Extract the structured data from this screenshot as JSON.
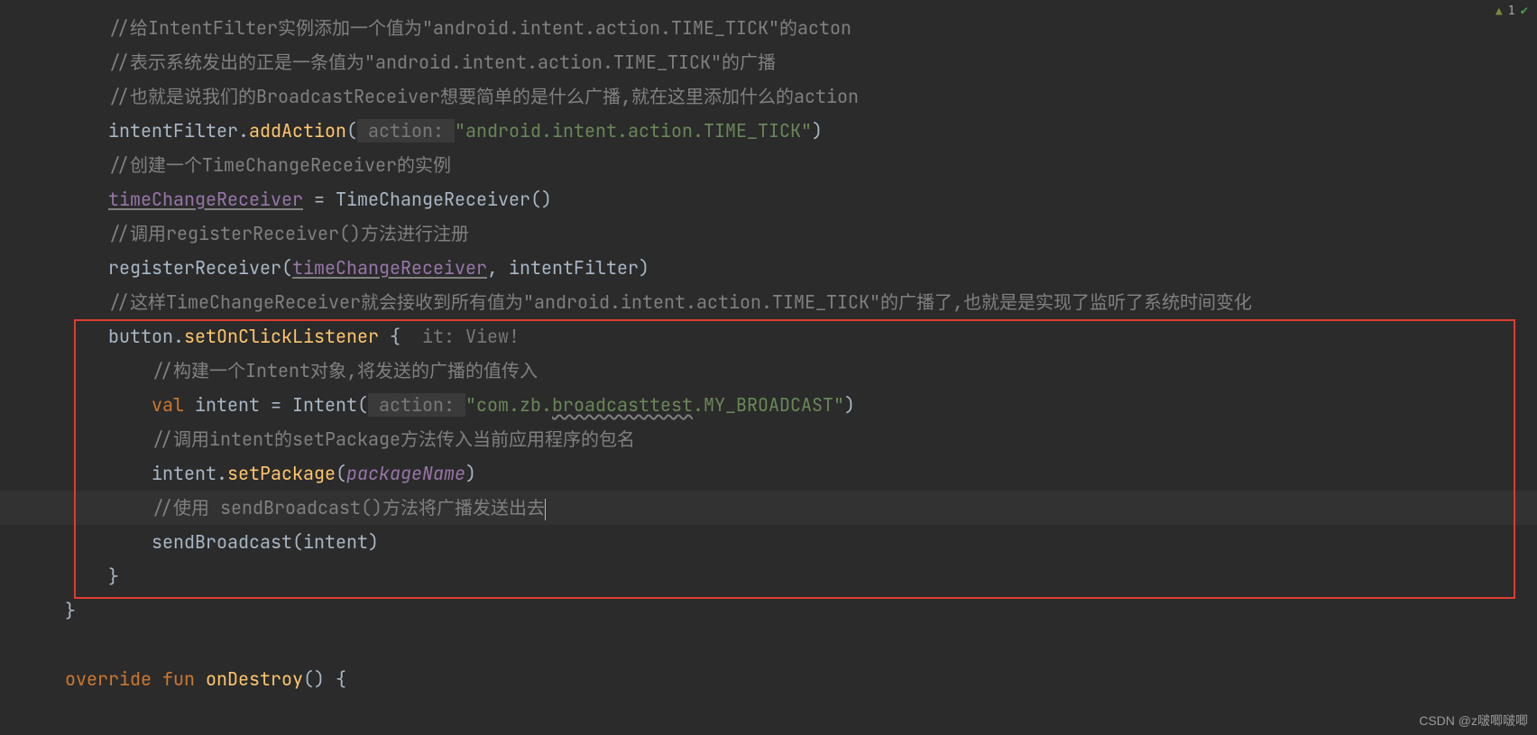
{
  "code": {
    "c1": "//给IntentFilter实例添加一个值为\"android.intent.action.TIME_TICK\"的acton",
    "c2": "//表示系统发出的正是一条值为\"android.intent.action.TIME_TICK\"的广播",
    "c3": "//也就是说我们的BroadcastReceiver想要简单的是什么广播,就在这里添加什么的action",
    "l4_a": "intentFilter.",
    "l4_fn": "addAction",
    "l4_p1": "(",
    "l4_hint": " action: ",
    "l4_str": "\"android.intent.action.TIME_TICK\"",
    "l4_p2": ")",
    "c5": "//创建一个TimeChangeReceiver的实例",
    "l6_a": "timeChangeReceiver",
    "l6_b": " = TimeChangeReceiver()",
    "c7": "//调用registerReceiver()方法进行注册",
    "l8_a": "registerReceiver(",
    "l8_b": "timeChangeReceiver",
    "l8_c": ", intentFilter)",
    "c9": "//这样TimeChangeReceiver就会接收到所有值为\"android.intent.action.TIME_TICK\"的广播了,也就是是实现了监听了系统时间变化",
    "l10_a": "button.",
    "l10_fn": "setOnClickListener",
    "l10_b": " {",
    "l10_hint": "  it: View!",
    "c11": "//构建一个Intent对象,将发送的广播的值传入",
    "l12_kw": "val",
    "l12_a": " intent = Intent(",
    "l12_hint": " action: ",
    "l12_str1": "\"com.zb.",
    "l12_str2": "broadcasttest",
    "l12_str3": ".MY_BROADCAST\"",
    "l12_b": ")",
    "c13": "//调用intent的setPackage方法传入当前应用程序的包名",
    "l14_a": "intent.",
    "l14_fn": "setPackage",
    "l14_b": "(",
    "l14_p": "packageName",
    "l14_c": ")",
    "c15": "//使用 sendBroadcast()方法将广播发送出去",
    "l16_a": "sendBroadcast(intent)",
    "l17": "}",
    "l18": "}",
    "l20_kw1": "override",
    "l20_kw2": "fun",
    "l20_fn": "onDestroy",
    "l20_b": "() {"
  },
  "status": {
    "warn_count": "1"
  },
  "watermark": "CSDN @z啵唧啵唧"
}
